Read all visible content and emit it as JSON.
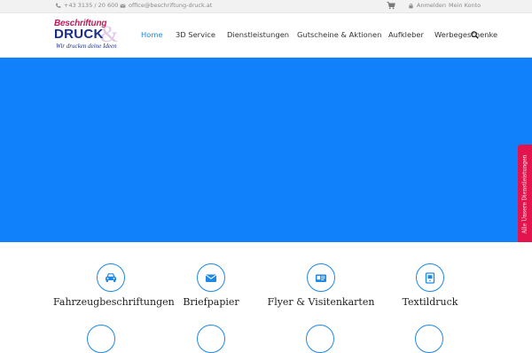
{
  "topbar": {
    "phone": "+43 3135 / 20 600",
    "email": "office@beschriftung-druck.at",
    "login": "Anmelden",
    "account": "Mein Konto"
  },
  "logo": {
    "line1": "Beschriftung",
    "line2": "DRUCK",
    "amp": "&",
    "tagline": "Wir drucken deine Ideen"
  },
  "nav": {
    "items": [
      "Home",
      "3D Service",
      "Dienstleistungen",
      "Gutscheine & Aktionen",
      "Aufkleber",
      "Werbegeschenke"
    ],
    "active": "Home"
  },
  "sidetab": {
    "label": "Alle Unsere Dienstleistungen"
  },
  "services": {
    "items": [
      {
        "label": "Fahrzeugbeschriftungen",
        "icon": "car-icon"
      },
      {
        "label": "Briefpapier",
        "icon": "envelope-icon"
      },
      {
        "label": "Flyer & Visitenkarten",
        "icon": "id-card-icon"
      },
      {
        "label": "Textildruck",
        "icon": "shirt-icon"
      }
    ]
  },
  "colors": {
    "accent": "#1e88e5",
    "hero": "#1180fb",
    "sidetab": "#e3134e"
  }
}
